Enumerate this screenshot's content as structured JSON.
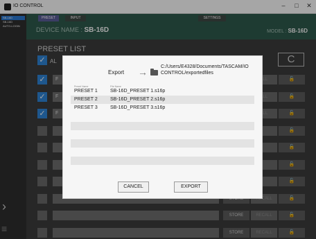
{
  "window": {
    "title": "IO CONTROL",
    "minimize": "–",
    "maximize": "□",
    "close": "✕"
  },
  "sidebar": {
    "devices": [
      "SB-16D",
      "SB-16D",
      "AUTO-LOGIN"
    ],
    "next_glyph": "›",
    "menu_glyph": "≡"
  },
  "header": {
    "tabs": [
      "PRESET",
      "INPUT",
      "SETTINGS"
    ],
    "device_name_label": "DEVICE NAME : ",
    "device_name": "SB-16D",
    "model_label": "MODEL : ",
    "model": "SB-16D"
  },
  "preset_list": {
    "title": "PRESET LIST",
    "all_label": "AL",
    "refresh_glyph": "C",
    "rows": [
      {
        "checked": true,
        "name": "F",
        "store": "",
        "recall": "ALL",
        "lock": "🔓"
      },
      {
        "checked": true,
        "name": "F",
        "store": "",
        "recall": "ALL",
        "lock": "🔓"
      },
      {
        "checked": true,
        "name": "F",
        "store": "",
        "recall": "ALL",
        "lock": "🔓"
      },
      {
        "checked": false,
        "name": "",
        "store": "",
        "recall": "",
        "lock": "🔓"
      },
      {
        "checked": false,
        "name": "",
        "store": "",
        "recall": "",
        "lock": "🔓"
      },
      {
        "checked": false,
        "name": "",
        "store": "",
        "recall": "",
        "lock": "🔓"
      },
      {
        "checked": false,
        "name": "",
        "store": "",
        "recall": "",
        "lock": "🔓"
      },
      {
        "checked": false,
        "name": "",
        "store": "STORE",
        "recall": "RECALL",
        "lock": "🔓"
      },
      {
        "checked": false,
        "name": "",
        "store": "STORE",
        "recall": "RECALL",
        "lock": "🔓"
      },
      {
        "checked": false,
        "name": "",
        "store": "STORE",
        "recall": "RECALL",
        "lock": "🔓"
      }
    ]
  },
  "dialog": {
    "title": "Export",
    "arrow": "→",
    "path": "C:/Users/E4328/Documents/TASCAM/IO CONTROL/exportedfiles",
    "col_preset_name": "Preset Name",
    "col_file_name": "File Name",
    "rows": [
      {
        "preset": "PRESET 1",
        "file": "SB-16D_PRESET 1.s16p"
      },
      {
        "preset": "PRESET 2",
        "file": "SB-16D_PRESET 2.s16p"
      },
      {
        "preset": "PRESET 3",
        "file": "SB-16D_PRESET 3.s16p"
      }
    ],
    "cancel_label": "CANCEL",
    "export_label": "EXPORT"
  }
}
